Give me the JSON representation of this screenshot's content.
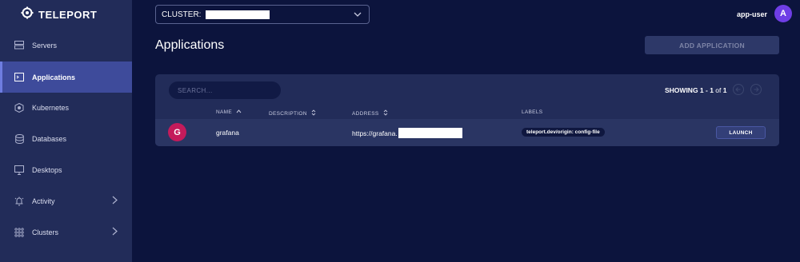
{
  "brand": {
    "logo_text": "TELEPORT"
  },
  "sidebar": {
    "items": [
      {
        "label": "Servers",
        "icon": "server-icon"
      },
      {
        "label": "Applications",
        "icon": "terminal-window-icon",
        "active": true
      },
      {
        "label": "Kubernetes",
        "icon": "kubernetes-icon"
      },
      {
        "label": "Databases",
        "icon": "database-icon"
      },
      {
        "label": "Desktops",
        "icon": "monitor-icon"
      },
      {
        "label": "Activity",
        "icon": "activity-icon",
        "expandable": true
      },
      {
        "label": "Clusters",
        "icon": "grid-icon",
        "expandable": true
      }
    ]
  },
  "topbar": {
    "cluster_label": "CLUSTER:",
    "user_name": "app-user",
    "avatar_initial": "A"
  },
  "page": {
    "title": "Applications",
    "add_button_label": "ADD APPLICATION"
  },
  "table": {
    "search_placeholder": "SEARCH...",
    "showing_prefix": "SHOWING ",
    "showing_range": "1 - 1",
    "showing_of": " of ",
    "showing_total": "1",
    "columns": {
      "name": "NAME",
      "description": "DESCRIPTION",
      "address": "ADDRESS",
      "labels": "LABELS"
    },
    "rows": [
      {
        "icon_letter": "G",
        "name": "grafana",
        "description": "",
        "address": "https://grafana.",
        "label": "teleport.dev/origin: config-file",
        "action": "LAUNCH"
      }
    ]
  },
  "colors": {
    "background": "#0c143d",
    "sidebar": "#222c59",
    "active_nav": "#3e4b9b",
    "avatar": "#6f3ee6",
    "app_icon": "#c41b5b"
  }
}
